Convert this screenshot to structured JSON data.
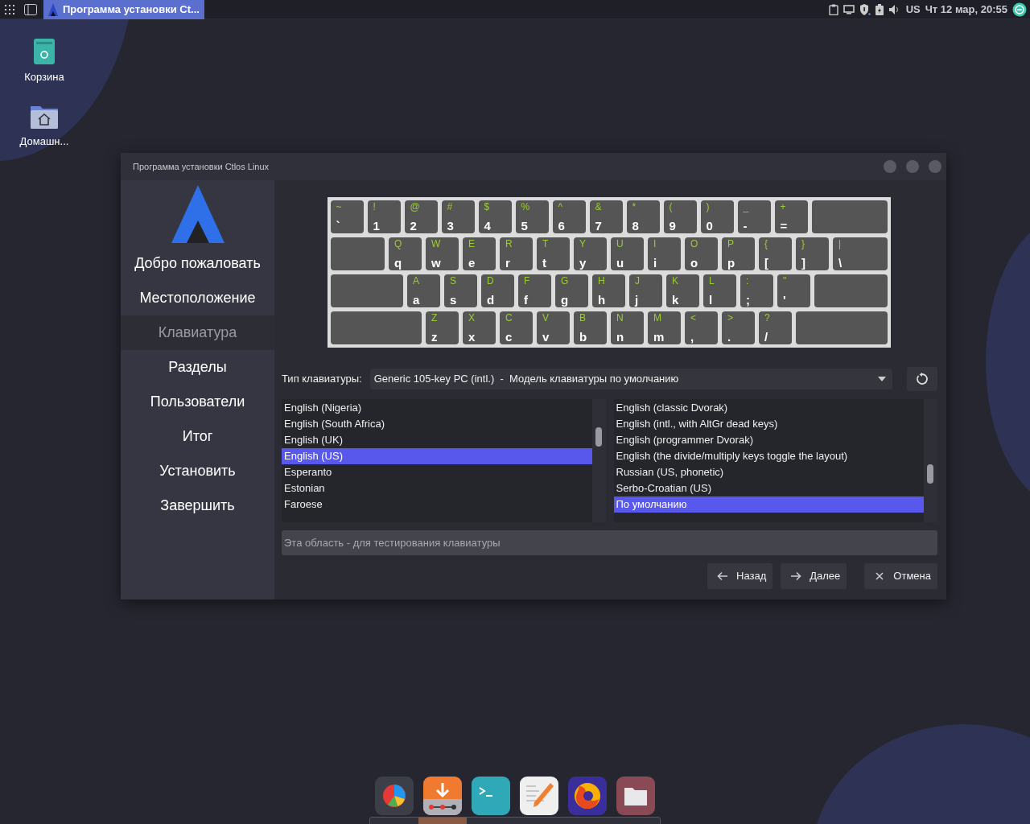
{
  "top_panel": {
    "task": {
      "title": "Программа установки Ct...",
      "selected": true
    },
    "layout": "US",
    "clock": "Чт 12 мар, 20:55"
  },
  "desktop_icons": [
    {
      "kind": "trash",
      "label": "Корзина"
    },
    {
      "kind": "home",
      "label": "Домашн..."
    }
  ],
  "window": {
    "title": "Программа установки Ctlos Linux",
    "sidebar": [
      {
        "label": "Добро пожаловать",
        "selected": false
      },
      {
        "label": "Местоположение",
        "selected": false
      },
      {
        "label": "Клавиатура",
        "selected": true
      },
      {
        "label": "Разделы",
        "selected": false
      },
      {
        "label": "Пользователи",
        "selected": false
      },
      {
        "label": "Итог",
        "selected": false
      },
      {
        "label": "Установить",
        "selected": false
      },
      {
        "label": "Завершить",
        "selected": false
      }
    ],
    "keyboard": [
      [
        {
          "kind": "char",
          "shift": "~",
          "base": "`"
        },
        {
          "kind": "char",
          "shift": "!",
          "base": "1"
        },
        {
          "kind": "char",
          "shift": "@",
          "base": "2"
        },
        {
          "kind": "char",
          "shift": "#",
          "base": "3"
        },
        {
          "kind": "char",
          "shift": "$",
          "base": "4"
        },
        {
          "kind": "char",
          "shift": "%",
          "base": "5"
        },
        {
          "kind": "char",
          "shift": "^",
          "base": "6"
        },
        {
          "kind": "char",
          "shift": "&",
          "base": "7"
        },
        {
          "kind": "char",
          "shift": "*",
          "base": "8"
        },
        {
          "kind": "char",
          "shift": "(",
          "base": "9"
        },
        {
          "kind": "char",
          "shift": ")",
          "base": "0"
        },
        {
          "kind": "char",
          "shift": "_",
          "base": "-"
        },
        {
          "kind": "char",
          "shift": "+",
          "base": "="
        },
        {
          "kind": "modifier"
        }
      ],
      [
        {
          "kind": "modifier"
        },
        {
          "kind": "char",
          "shift": "Q",
          "base": "q"
        },
        {
          "kind": "char",
          "shift": "W",
          "base": "w"
        },
        {
          "kind": "char",
          "shift": "E",
          "base": "e"
        },
        {
          "kind": "char",
          "shift": "R",
          "base": "r"
        },
        {
          "kind": "char",
          "shift": "T",
          "base": "t"
        },
        {
          "kind": "char",
          "shift": "Y",
          "base": "y"
        },
        {
          "kind": "char",
          "shift": "U",
          "base": "u"
        },
        {
          "kind": "char",
          "shift": "I",
          "base": "i"
        },
        {
          "kind": "char",
          "shift": "O",
          "base": "o"
        },
        {
          "kind": "char",
          "shift": "P",
          "base": "p"
        },
        {
          "kind": "char",
          "shift": "{",
          "base": "["
        },
        {
          "kind": "char",
          "shift": "}",
          "base": "]"
        },
        {
          "kind": "wide",
          "shift": "|",
          "base": "\\"
        }
      ],
      [
        {
          "kind": "modifier"
        },
        {
          "kind": "char",
          "shift": "A",
          "base": "a"
        },
        {
          "kind": "char",
          "shift": "S",
          "base": "s"
        },
        {
          "kind": "char",
          "shift": "D",
          "base": "d"
        },
        {
          "kind": "char",
          "shift": "F",
          "base": "f"
        },
        {
          "kind": "char",
          "shift": "G",
          "base": "g"
        },
        {
          "kind": "char",
          "shift": "H",
          "base": "h"
        },
        {
          "kind": "char",
          "shift": "J",
          "base": "j"
        },
        {
          "kind": "char",
          "shift": "K",
          "base": "k"
        },
        {
          "kind": "char",
          "shift": "L",
          "base": "l"
        },
        {
          "kind": "char",
          "shift": ":",
          "base": ";"
        },
        {
          "kind": "char",
          "shift": "\"",
          "base": "'"
        },
        {
          "kind": "modifier"
        }
      ],
      [
        {
          "kind": "modifier"
        },
        {
          "kind": "char",
          "shift": "Z",
          "base": "z"
        },
        {
          "kind": "char",
          "shift": "X",
          "base": "x"
        },
        {
          "kind": "char",
          "shift": "C",
          "base": "c"
        },
        {
          "kind": "char",
          "shift": "V",
          "base": "v"
        },
        {
          "kind": "char",
          "shift": "B",
          "base": "b"
        },
        {
          "kind": "char",
          "shift": "N",
          "base": "n"
        },
        {
          "kind": "char",
          "shift": "M",
          "base": "m"
        },
        {
          "kind": "char",
          "shift": "<",
          "base": ","
        },
        {
          "kind": "char",
          "shift": ">",
          "base": "."
        },
        {
          "kind": "char",
          "shift": "?",
          "base": "/"
        },
        {
          "kind": "modifier"
        }
      ]
    ],
    "model_label": "Тип клавиатуры:",
    "model_value": "Generic 105-key PC (intl.)  -  Модель клавиатуры по умолчанию",
    "layouts": [
      {
        "label": "English (Nigeria)",
        "selected": false
      },
      {
        "label": "English (South Africa)",
        "selected": false
      },
      {
        "label": "English (UK)",
        "selected": false
      },
      {
        "label": "English (US)",
        "selected": true
      },
      {
        "label": "Esperanto",
        "selected": false
      },
      {
        "label": "Estonian",
        "selected": false
      },
      {
        "label": "Faroese",
        "selected": false
      }
    ],
    "variants": [
      {
        "label": "English (classic Dvorak)",
        "selected": false
      },
      {
        "label": "English (intl., with AltGr dead keys)",
        "selected": false
      },
      {
        "label": "English (programmer Dvorak)",
        "selected": false
      },
      {
        "label": "English (the divide/multiply keys toggle the layout)",
        "selected": false
      },
      {
        "label": "Russian (US, phonetic)",
        "selected": false
      },
      {
        "label": "Serbo-Croatian (US)",
        "selected": false
      },
      {
        "label": "По умолчанию",
        "selected": true
      }
    ],
    "test_field": {
      "placeholder": "Эта область - для тестирования клавиатуры"
    },
    "buttons": [
      {
        "kind": "back",
        "label": "Назад"
      },
      {
        "kind": "next",
        "label": "Далее"
      },
      {
        "kind": "cancel",
        "label": "Отмена"
      }
    ]
  },
  "dock": [
    {
      "kind": "chart",
      "active": false
    },
    {
      "kind": "download",
      "active": true
    },
    {
      "kind": "terminal",
      "active": false
    },
    {
      "kind": "editor",
      "active": false
    },
    {
      "kind": "browser",
      "active": false
    },
    {
      "kind": "folder",
      "active": false
    }
  ]
}
